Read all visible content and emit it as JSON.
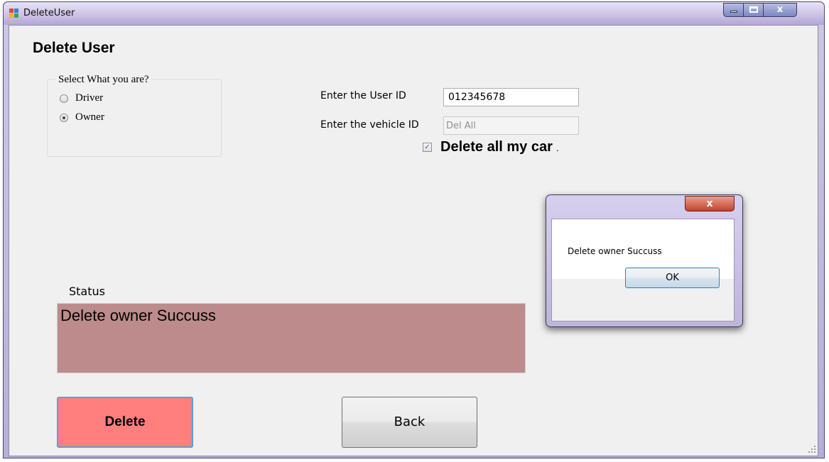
{
  "window": {
    "title": "DeleteUser"
  },
  "form": {
    "heading": "Delete User",
    "role_group": {
      "legend": "Select What you are?",
      "options": [
        {
          "label": "Driver",
          "selected": false
        },
        {
          "label": "Owner",
          "selected": true
        }
      ]
    },
    "user_id": {
      "label": "Enter the User ID",
      "value": "012345678"
    },
    "vehicle_id": {
      "label": "Enter the vehicle ID",
      "value": "Del All",
      "enabled": false
    },
    "delete_all": {
      "label": "Delete all my car",
      "suffix": ".",
      "checked": true
    },
    "status": {
      "label": "Status",
      "text": "Delete owner Succuss",
      "color": "#bd8b8b"
    },
    "buttons": {
      "delete_label": "Delete",
      "back_label": "Back",
      "delete_color": "#ff7f7f"
    }
  },
  "message_box": {
    "text": "Delete owner Succuss",
    "ok_label": "OK",
    "close_glyph": "x"
  },
  "controls": {
    "minimize_icon": "minimize-icon",
    "maximize_icon": "maximize-icon",
    "close_glyph": "x"
  }
}
